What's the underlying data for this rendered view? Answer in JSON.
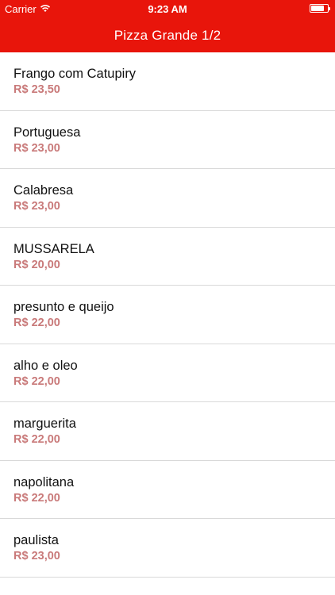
{
  "status_bar": {
    "carrier": "Carrier",
    "time": "9:23 AM",
    "battery_level": 0.8
  },
  "navbar": {
    "title": "Pizza Grande 1/2"
  },
  "colors": {
    "accent": "#e8150b",
    "price": "#c97a7a"
  },
  "items": [
    {
      "name": "Frango com Catupiry",
      "price": "R$ 23,50"
    },
    {
      "name": "Portuguesa",
      "price": "R$ 23,00"
    },
    {
      "name": "Calabresa",
      "price": "R$ 23,00"
    },
    {
      "name": "MUSSARELA",
      "price": "R$ 20,00"
    },
    {
      "name": "presunto e queijo",
      "price": "R$ 22,00"
    },
    {
      "name": "alho e oleo",
      "price": "R$ 22,00"
    },
    {
      "name": "marguerita",
      "price": "R$ 22,00"
    },
    {
      "name": "napolitana",
      "price": "R$ 22,00"
    },
    {
      "name": "paulista",
      "price": "R$ 23,00"
    }
  ]
}
